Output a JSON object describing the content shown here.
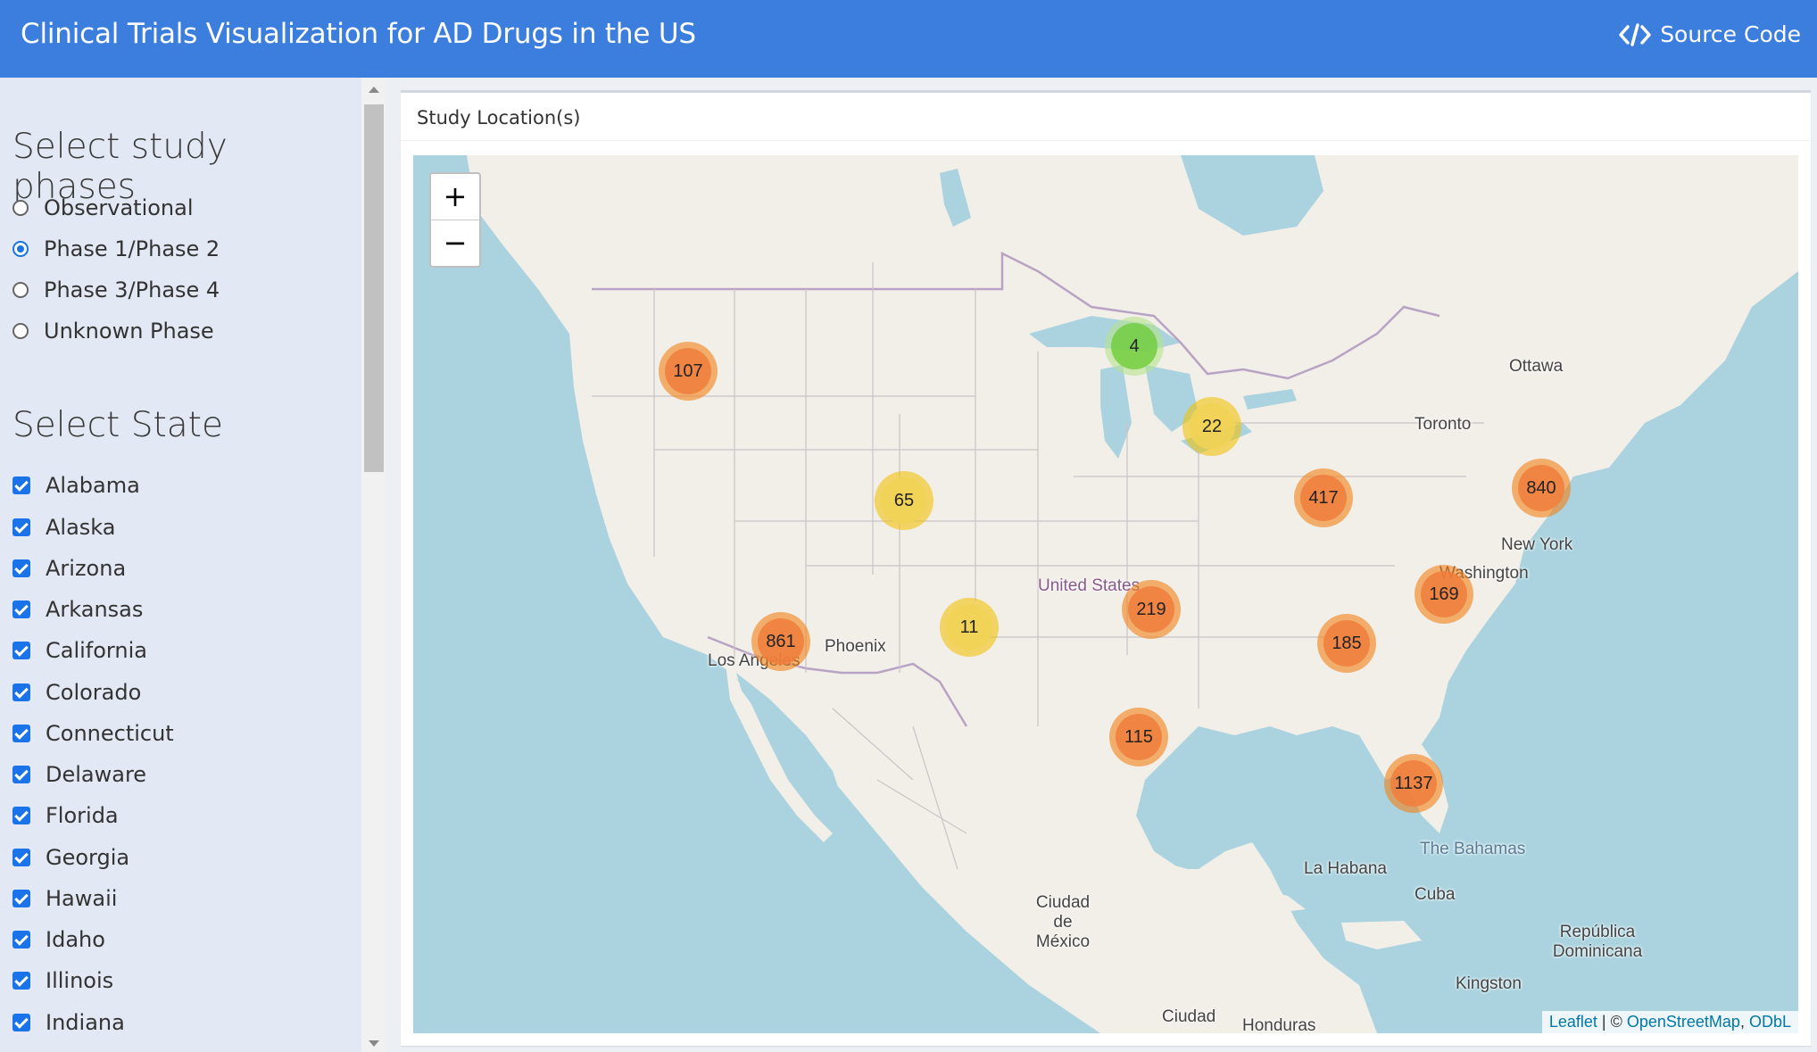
{
  "header": {
    "title": "Clinical Trials Visualization for AD Drugs in the US",
    "source_code_label": "Source Code",
    "source_icon": "code-icon",
    "background_color": "#3c7ede"
  },
  "sidebar": {
    "phases_heading": "Select study phases",
    "phases": [
      {
        "label": "Observational",
        "selected": false
      },
      {
        "label": "Phase 1/Phase 2",
        "selected": true
      },
      {
        "label": "Phase 3/Phase 4",
        "selected": false
      },
      {
        "label": "Unknown Phase",
        "selected": false
      }
    ],
    "state_heading": "Select State",
    "states": [
      {
        "label": "Alabama",
        "checked": true
      },
      {
        "label": "Alaska",
        "checked": true
      },
      {
        "label": "Arizona",
        "checked": true
      },
      {
        "label": "Arkansas",
        "checked": true
      },
      {
        "label": "California",
        "checked": true
      },
      {
        "label": "Colorado",
        "checked": true
      },
      {
        "label": "Connecticut",
        "checked": true
      },
      {
        "label": "Delaware",
        "checked": true
      },
      {
        "label": "Florida",
        "checked": true
      },
      {
        "label": "Georgia",
        "checked": true
      },
      {
        "label": "Hawaii",
        "checked": true
      },
      {
        "label": "Idaho",
        "checked": true
      },
      {
        "label": "Illinois",
        "checked": true
      },
      {
        "label": "Indiana",
        "checked": true
      }
    ]
  },
  "panel": {
    "title": "Study Location(s)"
  },
  "map": {
    "zoom_in_label": "+",
    "zoom_out_label": "−",
    "clusters": [
      {
        "count": "107",
        "size": "large"
      },
      {
        "count": "4",
        "size": "small"
      },
      {
        "count": "22",
        "size": "medium"
      },
      {
        "count": "65",
        "size": "medium"
      },
      {
        "count": "417",
        "size": "large"
      },
      {
        "count": "840",
        "size": "large"
      },
      {
        "count": "169",
        "size": "large"
      },
      {
        "count": "219",
        "size": "large"
      },
      {
        "count": "861",
        "size": "large"
      },
      {
        "count": "11",
        "size": "medium"
      },
      {
        "count": "185",
        "size": "large"
      },
      {
        "count": "115",
        "size": "large"
      },
      {
        "count": "1137",
        "size": "large"
      }
    ],
    "places": [
      "Ottawa",
      "Toronto",
      "New York",
      "Washington",
      "United States",
      "Phoenix",
      "Los Angeles",
      "The Bahamas",
      "La Habana",
      "Cuba",
      "Ciudad de México",
      "República Dominicana",
      "Kingston",
      "Ciudad",
      "Honduras"
    ],
    "attribution": {
      "leaflet": "Leaflet",
      "separator": " | © ",
      "osm": "OpenStreetMap",
      "comma": ", ",
      "odbl": "ODbL"
    },
    "colors": {
      "water": "#aad3df",
      "land": "#f2efe9",
      "large": "#f07e3c",
      "medium": "#f1d357",
      "small": "#6ecc39"
    }
  }
}
